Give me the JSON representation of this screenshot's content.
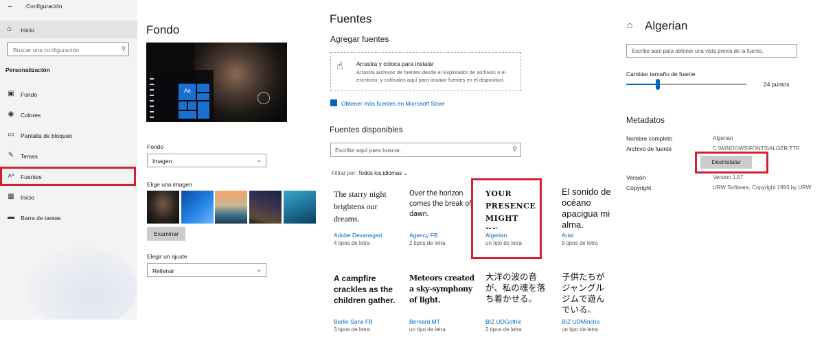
{
  "settings": {
    "window_title": "Configuración",
    "home_label": "Inicio",
    "search_placeholder": "Buscar una configuración",
    "section_title": "Personalización",
    "nav": [
      {
        "label": "Fondo",
        "icon": "image-icon"
      },
      {
        "label": "Colores",
        "icon": "palette-icon"
      },
      {
        "label": "Pantalla de bloqueo",
        "icon": "lock-screen-icon"
      },
      {
        "label": "Temas",
        "icon": "brush-icon"
      },
      {
        "label": "Fuentes",
        "icon": "fonts-icon"
      },
      {
        "label": "Inicio",
        "icon": "start-icon"
      },
      {
        "label": "Barra de tareas",
        "icon": "taskbar-icon"
      }
    ],
    "selected": "Fuentes"
  },
  "background": {
    "title": "Fondo",
    "preview_tile_label": "Aa",
    "fondo_label": "Fondo",
    "fondo_value": "Imagen",
    "choose_image_label": "Elige una imagen",
    "browse_button": "Examinar",
    "fit_label": "Elegir un ajuste",
    "fit_value": "Rellenar"
  },
  "fonts": {
    "title": "Fuentes",
    "add_heading": "Agregar fuentes",
    "drop_title": "Arrastra y coloca para instalar",
    "drop_desc": "Arrastra archivos de fuentes desde el Explorador de archivos o el escritorio, y colócalos aquí para instalar fuentes en el dispositivo.",
    "store_link": "Obtener más fuentes en Microsoft Store",
    "available_heading": "Fuentes disponibles",
    "search_placeholder": "Escribe aquí para buscar.",
    "filter_label": "Filtrar por:",
    "filter_value": "Todos los idiomas",
    "cards": [
      {
        "sample": "The starry night brightens our dreams.",
        "name": "Adobe Devanagari",
        "count": "4 tipos de letra"
      },
      {
        "sample": "Over the horizon comes the break of dawn.",
        "name": "Agency FB",
        "count": "2 tipos de letra"
      },
      {
        "sample": "YOUR PRESENCE MIGHT BE...",
        "name": "Algerian",
        "count": "un tipo de letra"
      },
      {
        "sample": "El sonido de océano apacigua mi alma.",
        "name": "Arial",
        "count": "9 tipos de letra"
      },
      {
        "sample": "A campfire crackles as the children gather.",
        "name": "Berlin Sans FB",
        "count": "3 tipos de letra"
      },
      {
        "sample": "Meteors created a sky-symphony of light.",
        "name": "Bernard MT",
        "count": "un tipo de letra"
      },
      {
        "sample": "大洋の波の音が、私の魂を落ち着かせる。",
        "name": "BIZ UDGothic",
        "count": "2 tipos de letra"
      },
      {
        "sample": "子供たちがジャングルジムで遊んでいる。",
        "name": "BIZ UDMincho",
        "count": "un tipo de letra"
      }
    ]
  },
  "detail": {
    "title": "Algerian",
    "preview_placeholder": "Escribe aquí para obtener una vista previa de la fuente.",
    "size_label": "Cambiar tamaño de fuente",
    "size_value": "24 puntos",
    "size_fraction": 0.26,
    "metadata_heading": "Metadatos",
    "full_name_label": "Nombre completo",
    "full_name_value": "Algerian",
    "file_label": "Archivo de fuente",
    "file_value": "C:\\WINDOWS\\FONTS\\ALGER.TTF",
    "uninstall_button": "Desinstalar",
    "version_label": "Versión",
    "version_value": "Version 1.57",
    "copyright_label": "Copyright",
    "copyright_value": "URW Software, Copyright 1993 by URW"
  },
  "colors": {
    "accent": "#0067c0",
    "highlight": "#d3202e"
  }
}
